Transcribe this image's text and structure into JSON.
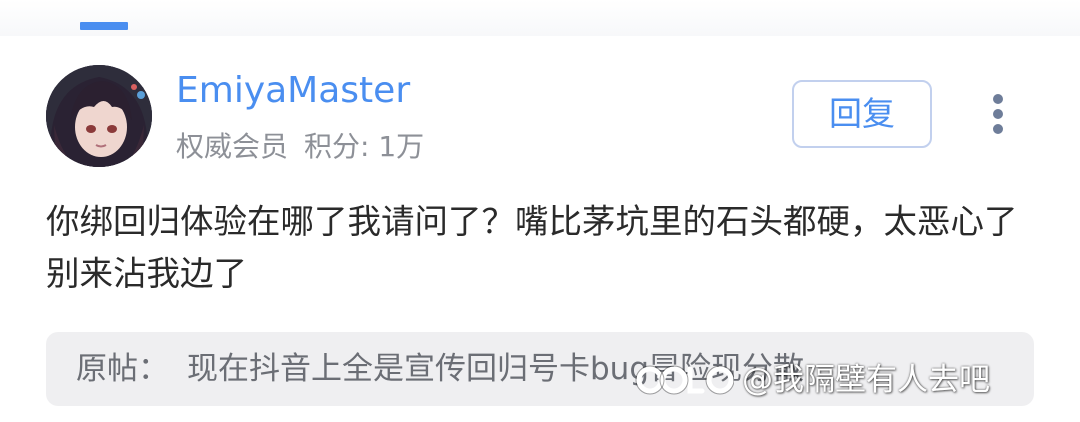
{
  "post": {
    "username": "EmiyaMaster",
    "badge": "权威会员",
    "points_label": "积分:",
    "points_value": "1万",
    "reply_label": "回复",
    "body": "你绑回归体验在哪了我请问了？嘴比茅坑里的石头都硬，太恶心了别来沾我边了",
    "quote_prefix": "原帖：",
    "quote_text": "现在抖音上全是宣传回归号卡bug冒险现分散"
  },
  "watermark": {
    "text": "@我隔壁有人去吧"
  },
  "icons": {
    "more": "more-vertical-icon",
    "avatar": "user-avatar-image",
    "logo": "platform-logo-icon"
  },
  "colors": {
    "accent": "#4a8ef0",
    "meta_text": "#8d9097",
    "body_text": "#2a2a2a",
    "quote_bg": "#efeff1"
  }
}
